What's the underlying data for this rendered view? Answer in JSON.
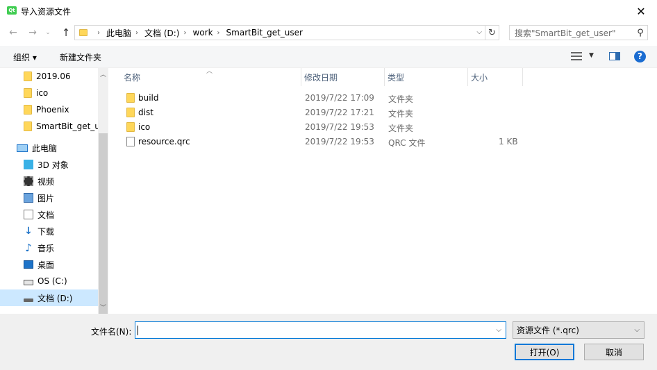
{
  "window": {
    "title": "导入资源文件",
    "app_icon_text": "Qt"
  },
  "address": {
    "crumbs": [
      "此电脑",
      "文档 (D:)",
      "work",
      "SmartBit_get_user"
    ]
  },
  "search": {
    "placeholder": "搜索\"SmartBit_get_user\""
  },
  "toolbar": {
    "organize": "组织 ▾",
    "new_folder": "新建文件夹"
  },
  "nav": {
    "items": [
      {
        "label": "2019.06",
        "icon": "folder-icon"
      },
      {
        "label": "ico",
        "icon": "folder-icon"
      },
      {
        "label": "Phoenix",
        "icon": "folder-icon"
      },
      {
        "label": "SmartBit_get_user",
        "icon": "folder-icon"
      },
      {
        "label": "此电脑",
        "icon": "computer-icon"
      },
      {
        "label": "3D 对象",
        "icon": "3d-objects-icon"
      },
      {
        "label": "视频",
        "icon": "video-icon"
      },
      {
        "label": "图片",
        "icon": "pictures-icon"
      },
      {
        "label": "文档",
        "icon": "documents-icon"
      },
      {
        "label": "下载",
        "icon": "download-icon"
      },
      {
        "label": "音乐",
        "icon": "music-icon"
      },
      {
        "label": "桌面",
        "icon": "desktop-icon"
      },
      {
        "label": "OS (C:)",
        "icon": "drive-c-icon"
      },
      {
        "label": "文档 (D:)",
        "icon": "drive-d-icon"
      }
    ]
  },
  "columns": {
    "name": "名称",
    "date": "修改日期",
    "type": "类型",
    "size": "大小"
  },
  "files": [
    {
      "name": "build",
      "date": "2019/7/22 17:09",
      "type": "文件夹",
      "size": ""
    },
    {
      "name": "dist",
      "date": "2019/7/22 17:21",
      "type": "文件夹",
      "size": ""
    },
    {
      "name": "ico",
      "date": "2019/7/22 19:53",
      "type": "文件夹",
      "size": ""
    },
    {
      "name": "resource.qrc",
      "date": "2019/7/22 19:53",
      "type": "QRC 文件",
      "size": "1 KB"
    }
  ],
  "bottom": {
    "filename_label": "文件名(N):",
    "filename_value": "",
    "filter": "资源文件 (*.qrc)",
    "open": "打开(O)",
    "cancel": "取消"
  },
  "colors": {
    "accent": "#0078d7",
    "selected": "#cce8ff",
    "folder": "#ffd75a"
  }
}
